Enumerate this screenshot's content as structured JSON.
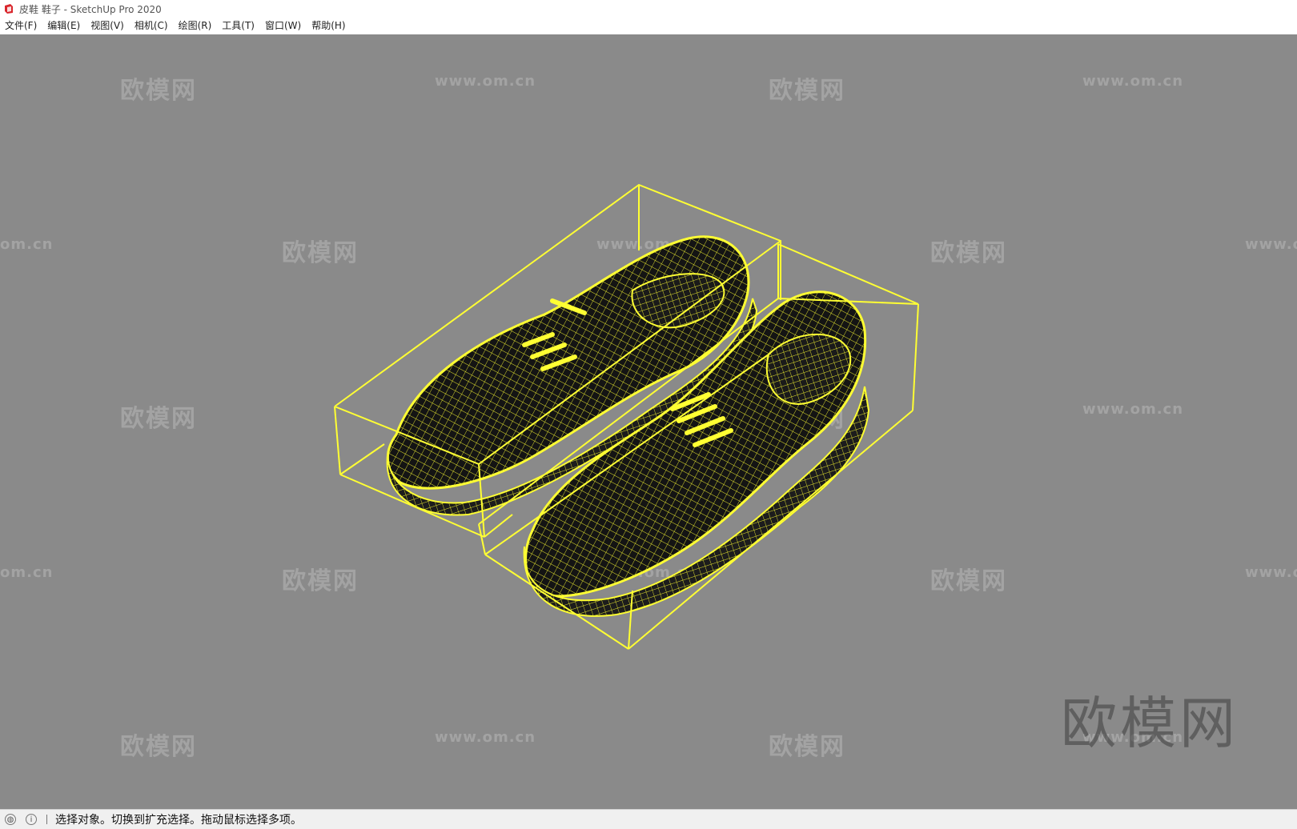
{
  "window": {
    "title": "皮鞋 鞋子 - SketchUp Pro 2020",
    "app_icon": "sketchup-icon"
  },
  "menu": {
    "items": [
      {
        "label": "文件(F)"
      },
      {
        "label": "编辑(E)"
      },
      {
        "label": "视图(V)"
      },
      {
        "label": "相机(C)"
      },
      {
        "label": "绘图(R)"
      },
      {
        "label": "工具(T)"
      },
      {
        "label": "窗口(W)"
      },
      {
        "label": "帮助(H)"
      }
    ]
  },
  "viewport": {
    "background_color": "#8a8a8a",
    "selection_color": "#ffff33",
    "watermark_logo": "欧模网",
    "watermark_url": "www.om.cn",
    "watermark_url_cut": "om.cn",
    "watermark_url_cut_right": "www.o",
    "big_watermark": "欧模网"
  },
  "status": {
    "icons": [
      "geo-location-icon",
      "info-icon"
    ],
    "text": "选择对象。切换到扩充选择。拖动鼠标选择多项。"
  }
}
